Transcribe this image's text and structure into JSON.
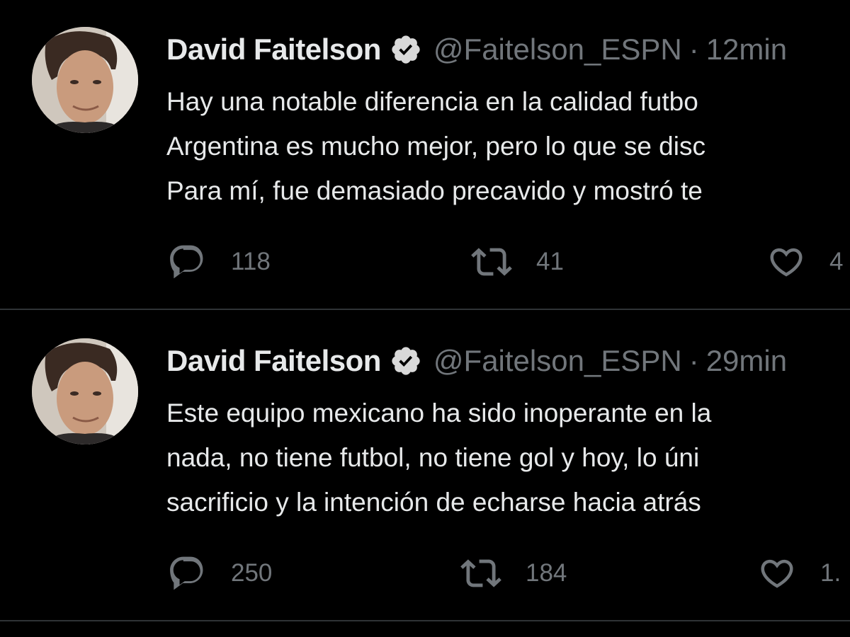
{
  "tweets": [
    {
      "display_name": "David Faitelson",
      "handle": "@Faitelson_ESPN",
      "separator": "·",
      "timestamp": "12min",
      "verified": true,
      "lines": [
        "Hay una notable diferencia en la calidad futbo",
        "Argentina es mucho mejor, pero lo que se disc",
        "Para mí, fue demasiado precavido y mostró te"
      ],
      "reply_count": "118",
      "retweet_count": "41",
      "like_count": "4"
    },
    {
      "display_name": "David Faitelson",
      "handle": "@Faitelson_ESPN",
      "separator": "·",
      "timestamp": "29min",
      "verified": true,
      "lines": [
        "Este equipo mexicano ha sido inoperante en la",
        "nada, no tiene futbol, no tiene gol y hoy, lo úni",
        "sacrificio y la intención de echarse hacia atrás"
      ],
      "reply_count": "250",
      "retweet_count": "184",
      "like_count": "1."
    }
  ],
  "colors": {
    "background": "#000000",
    "primary_text": "#e7e9ea",
    "secondary_text": "#71767b",
    "divider": "#2f3336"
  },
  "icons": {
    "verified": "verified-badge-icon",
    "reply": "reply-bubble-icon",
    "retweet": "retweet-icon",
    "like": "heart-icon"
  }
}
